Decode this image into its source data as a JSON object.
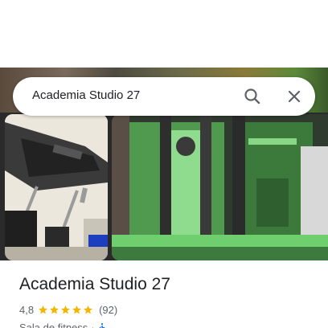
{
  "search": {
    "query": "Academia Studio 27",
    "search_icon": "search-icon",
    "close_icon": "close-icon"
  },
  "place": {
    "name": "Academia Studio 27",
    "rating": "4,8",
    "stars": 5,
    "review_count": "(92)",
    "category": "Sala de fitness",
    "separator": "·",
    "accessibility_icon": "wheelchair-accessible-icon"
  },
  "colors": {
    "star": "#f4b400",
    "accessibility": "#1a73e8",
    "text_primary": "#202124",
    "text_secondary": "#5f6368"
  }
}
